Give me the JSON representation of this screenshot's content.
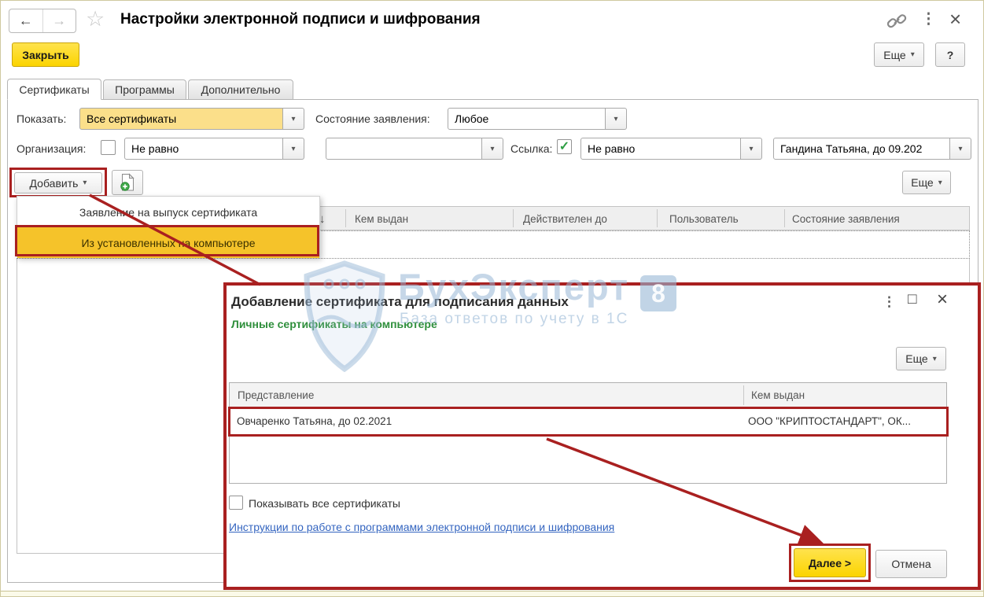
{
  "window": {
    "title": "Настройки электронной подписи и шифрования",
    "close_button": "Закрыть",
    "more_button": "Еще",
    "help_button": "?"
  },
  "icons": {
    "back": "←",
    "forward": "→",
    "favorite": "☆",
    "menu_dots": "⋮",
    "close": "×",
    "dropdown": "▾",
    "check": "✓",
    "sort_desc": "↓",
    "maximize": "□"
  },
  "tabs": [
    {
      "label": "Сертификаты",
      "active": true
    },
    {
      "label": "Программы",
      "active": false
    },
    {
      "label": "Дополнительно",
      "active": false
    }
  ],
  "filters": {
    "show": {
      "label": "Показать:",
      "value": "Все сертификаты"
    },
    "application_state": {
      "label": "Состояние заявления:",
      "value": "Любое"
    },
    "organization": {
      "label": "Организация:",
      "comparison": "Не равно",
      "value": ""
    },
    "reference": {
      "label": "Ссылка:",
      "comparison": "Не равно",
      "value": "Гандина Татьяна, до 09.202"
    }
  },
  "toolbar": {
    "add_button": "Добавить",
    "more_button": "Еще"
  },
  "add_menu": {
    "items": [
      "Заявление на выпуск сертификата",
      "Из установленных на компьютере"
    ],
    "highlighted_index": 1
  },
  "certificates_table": {
    "headers": [
      "Кем выдан",
      "Действителен до",
      "Пользователь",
      "Состояние заявления"
    ]
  },
  "dialog": {
    "title": "Добавление сертификата для подписания данных",
    "subtitle": "Личные сертификаты на компьютере",
    "more_button": "Еще",
    "table": {
      "headers": [
        "Представление",
        "Кем выдан"
      ],
      "rows": [
        {
          "presentation": "Овчаренко Татьяна, до 02.2021",
          "issuer": "ООО \"КРИПТОСТАНДАРТ\", ОК..."
        }
      ]
    },
    "show_all_checkbox": "Показывать все сертификаты",
    "instructions_link": "Инструкции по работе с программами электронной подписи и шифрования",
    "next_button": "Далее >",
    "cancel_button": "Отмена"
  },
  "watermark": {
    "brand": "БухЭксперт",
    "badge": "8",
    "tagline": "База ответов по учету в 1С"
  },
  "colors": {
    "accent_yellow": "#ffd600",
    "menu_highlight": "#f5c32a",
    "field_highlight": "#fbdf8a",
    "annotation_red": "#a92020",
    "green_text": "#2f8f3c",
    "link_blue": "#3465c0"
  }
}
